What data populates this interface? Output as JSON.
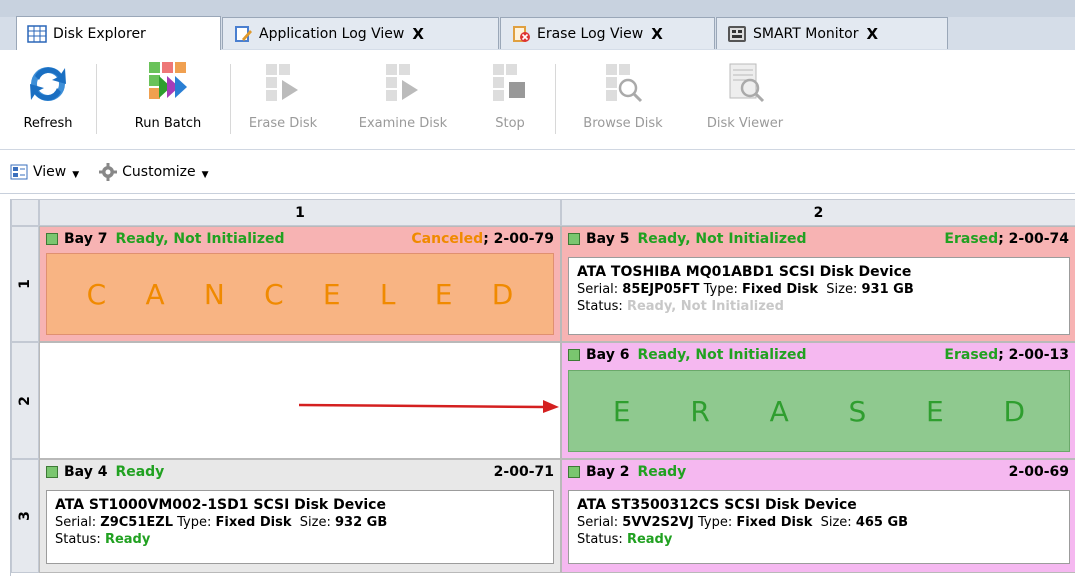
{
  "tabs": [
    {
      "label": "Disk Explorer",
      "icon": "disk-grid-icon"
    },
    {
      "label": "Application Log View",
      "close": "X",
      "icon": "app-log-icon"
    },
    {
      "label": "Erase Log View",
      "close": "X",
      "icon": "erase-log-icon"
    },
    {
      "label": "SMART Monitor",
      "close": "X",
      "icon": "smart-icon"
    }
  ],
  "ribbon": {
    "refresh": "Refresh",
    "run_batch": "Run Batch",
    "erase_disk": "Erase Disk",
    "examine_disk": "Examine Disk",
    "stop": "Stop",
    "browse_disk": "Browse Disk",
    "disk_viewer": "Disk Viewer"
  },
  "viewbar": {
    "view": "View",
    "customize": "Customize"
  },
  "grid": {
    "columns": [
      "1",
      "2"
    ],
    "rows": [
      "1",
      "2",
      "3"
    ]
  },
  "bays": {
    "bay7": {
      "name": "Bay 7",
      "status": "Ready, Not Initialized",
      "result": "Canceled",
      "sep": "; ",
      "code": "2-00-79",
      "big": [
        "C",
        "A",
        "N",
        "C",
        "E",
        "L",
        "E",
        "D"
      ]
    },
    "bay5": {
      "name": "Bay 5",
      "status": "Ready, Not Initialized",
      "result": "Erased",
      "sep": "; ",
      "code": "2-00-74",
      "device": "ATA TOSHIBA MQ01ABD1 SCSI Disk Device",
      "serial_label": "Serial: ",
      "serial": "85EJP05FT",
      "type_label": " Type: ",
      "type": "Fixed Disk",
      "size_label": "  Size: ",
      "size": "931 GB",
      "status_label": "Status: ",
      "status_value": "Ready, Not Initialized"
    },
    "bay6": {
      "name": "Bay 6",
      "status": "Ready, Not Initialized",
      "result": "Erased",
      "sep": "; ",
      "code": "2-00-13",
      "big": [
        "E",
        "R",
        "A",
        "S",
        "E",
        "D"
      ]
    },
    "bay4": {
      "name": "Bay 4",
      "status": "Ready",
      "code": "2-00-71",
      "device": "ATA ST1000VM002-1SD1 SCSI Disk Device",
      "serial_label": "Serial: ",
      "serial": "Z9C51EZL",
      "type_label": " Type: ",
      "type": "Fixed Disk",
      "size_label": "  Size: ",
      "size": "932 GB",
      "status_label": "Status: ",
      "status_value": "Ready"
    },
    "bay2": {
      "name": "Bay 2",
      "status": "Ready",
      "code": "2-00-69",
      "device": "ATA ST3500312CS SCSI Disk Device",
      "serial_label": "Serial: ",
      "serial": "5VV2S2VJ",
      "type_label": " Type: ",
      "type": "Fixed Disk",
      "size_label": "  Size: ",
      "size": "465 GB",
      "status_label": "Status: ",
      "status_value": "Ready"
    }
  },
  "colors": {
    "green_text": "#21a121",
    "canceled_orange": "#f08a00",
    "erased_green": "#2f9e2f",
    "bay_red": "#f7b3b3",
    "bay_pink": "#f5b8f0",
    "arrow_red": "#d42020"
  }
}
